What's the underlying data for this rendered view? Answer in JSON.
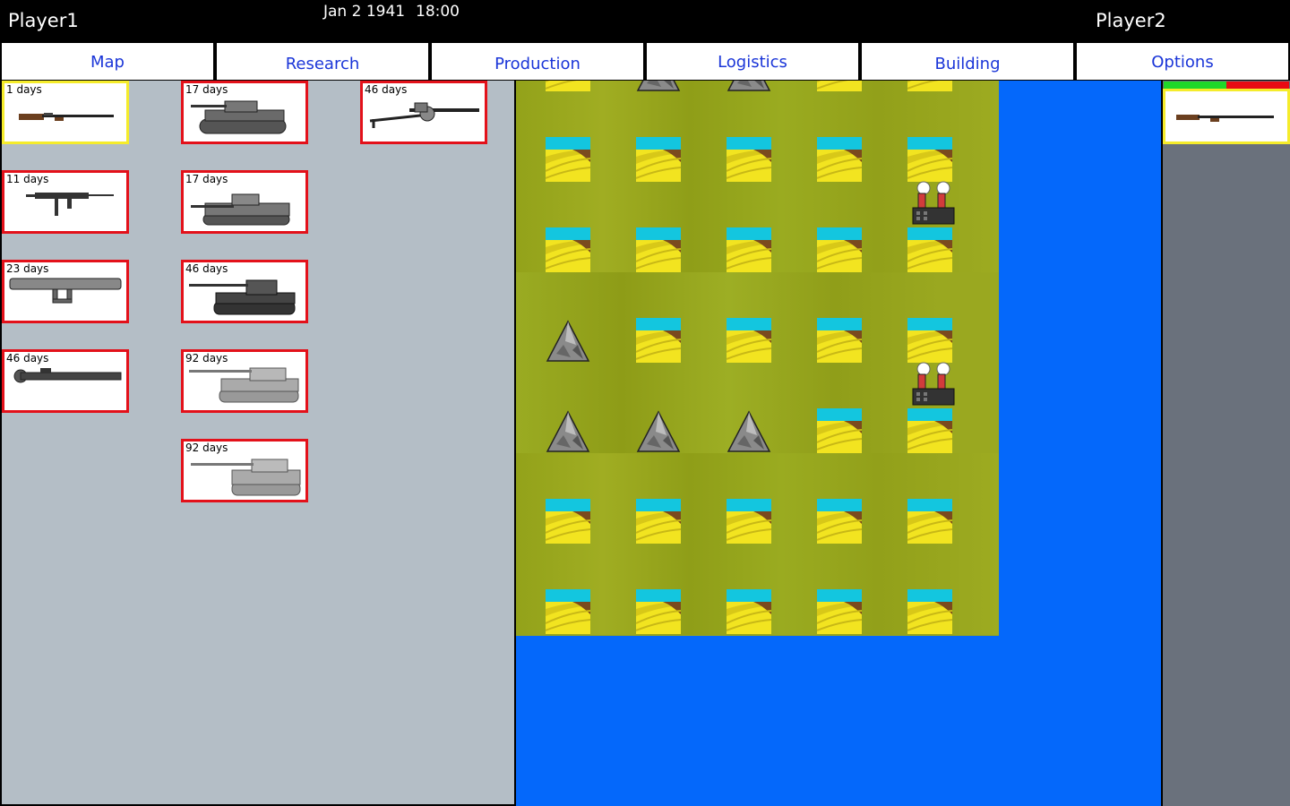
{
  "header": {
    "player1": "Player1",
    "player2": "Player2",
    "date": "Jan 2 1941",
    "time": "18:00"
  },
  "tabs": [
    {
      "label": "Map"
    },
    {
      "label": "Research"
    },
    {
      "label": "Production"
    },
    {
      "label": "Logistics"
    },
    {
      "label": "Building"
    },
    {
      "label": "Options"
    }
  ],
  "research": {
    "infantry_column": [
      {
        "days": "1 days",
        "icon": "rifle-icon",
        "selected": true
      },
      {
        "days": "11 days",
        "icon": "submachine-gun-icon",
        "selected": false
      },
      {
        "days": "23 days",
        "icon": "bazooka-icon",
        "selected": false
      },
      {
        "days": "46 days",
        "icon": "panzerschreck-icon",
        "selected": false
      }
    ],
    "armor_column": [
      {
        "days": "17 days",
        "icon": "panzer-iii-icon",
        "selected": false
      },
      {
        "days": "17 days",
        "icon": "panzer-iv-icon",
        "selected": false
      },
      {
        "days": "46 days",
        "icon": "panther-tank-icon",
        "selected": false
      },
      {
        "days": "92 days",
        "icon": "king-tiger-tank-icon",
        "selected": false
      },
      {
        "days": "92 days",
        "icon": "tiger-tank-icon",
        "selected": false
      }
    ],
    "artillery_column": [
      {
        "days": "46 days",
        "icon": "anti-tank-gun-icon",
        "selected": false
      }
    ]
  },
  "map": {
    "colors": {
      "water": "#0468fb",
      "grass": "#96a41c"
    },
    "rows": [
      [
        "farm",
        "mountain",
        "mountain",
        "farm",
        "farm"
      ],
      [
        "farm",
        "farm",
        "farm",
        "farm",
        "farm"
      ],
      [
        "farm",
        "farm",
        "farm",
        "farm",
        "factory-farm"
      ],
      [
        "mountain",
        "farm",
        "farm",
        "farm",
        "farm"
      ],
      [
        "mountain",
        "mountain",
        "mountain",
        "farm",
        "factory-farm"
      ],
      [
        "farm",
        "farm",
        "farm",
        "farm",
        "farm"
      ],
      [
        "farm",
        "farm",
        "farm",
        "farm",
        "farm"
      ]
    ]
  },
  "selected_unit": {
    "icon": "rifle-icon",
    "health_fraction": 0.5
  }
}
